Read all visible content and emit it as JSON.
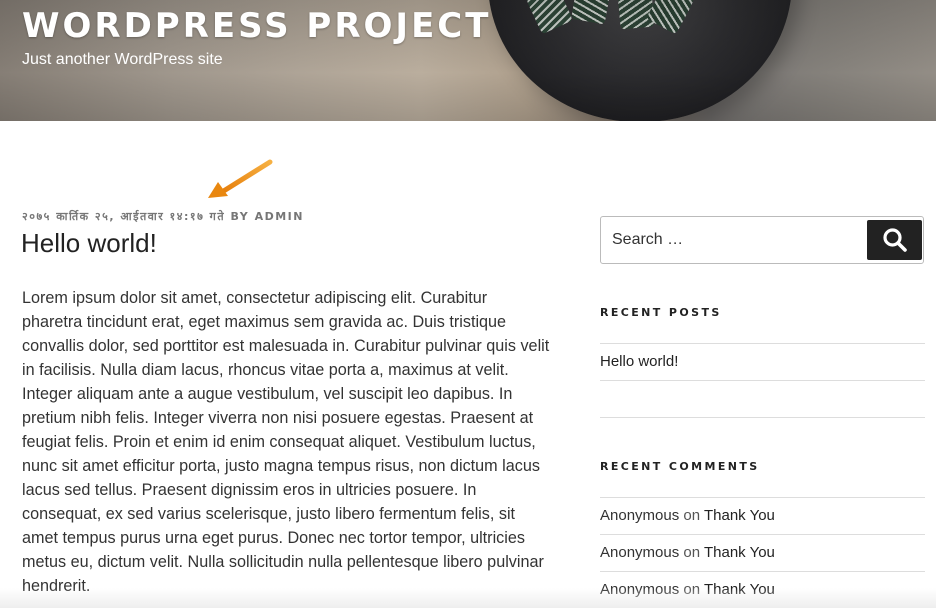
{
  "site": {
    "title": "WORDPRESS PROJECT",
    "description": "Just another WordPress site"
  },
  "post": {
    "date": "२०७५ कार्तिक २५, आईतवार १४:१७ गते",
    "by_label": "BY",
    "author": "ADMIN",
    "title": "Hello world!",
    "content": "Lorem ipsum dolor sit amet, consectetur adipiscing elit. Curabitur pharetra tincidunt erat, eget maximus sem gravida ac. Duis tristique convallis dolor, sed porttitor est malesuada in. Curabitur pulvinar quis velit in facilisis. Nulla diam lacus, rhoncus vitae porta a, maximus at velit. Integer aliquam ante a augue vestibulum, vel suscipit leo dapibus. In pretium nibh felis. Integer viverra non nisi posuere egestas. Praesent at feugiat felis. Proin et enim id enim consequat aliquet. Vestibulum luctus, nunc sit amet efficitur porta, justo magna tempus risus, non dictum lacus lacus sed tellus. Praesent dignissim eros in ultricies posuere. In consequat, ex sed varius scelerisque, justo libero fermentum felis, sit amet tempus purus urna eget purus. Donec nec tortor tempor, ultricies metus eu, dictum velit. Nulla sollicitudin nulla pellentesque libero pulvinar hendrerit."
  },
  "sidebar": {
    "search": {
      "placeholder": "Search …",
      "icon": "search-icon"
    },
    "recent_posts": {
      "title": "RECENT POSTS",
      "items": [
        {
          "label": "Hello world!"
        }
      ]
    },
    "recent_comments": {
      "title": "RECENT COMMENTS",
      "items": [
        {
          "author": "Anonymous",
          "on": "on",
          "post": "Thank You"
        },
        {
          "author": "Anonymous",
          "on": "on",
          "post": "Thank You"
        },
        {
          "author": "Anonymous",
          "on": "on",
          "post": "Thank You"
        }
      ]
    }
  },
  "colors": {
    "accent_arrow": "#f39c12",
    "search_button": "#222222",
    "meta_text": "#767676"
  }
}
